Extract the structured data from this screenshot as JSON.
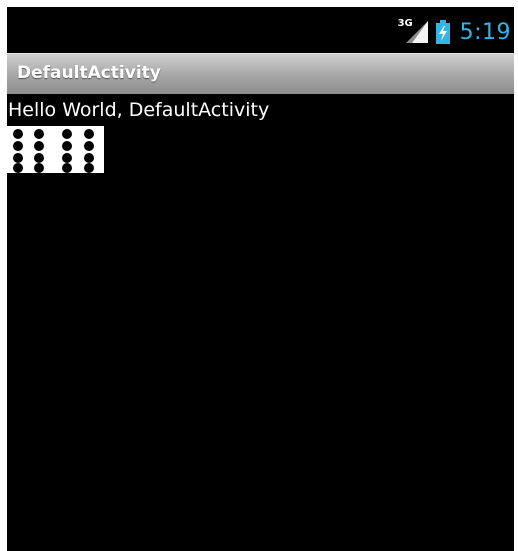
{
  "status_bar": {
    "network_label": "3G",
    "network_icon": "signal-icon",
    "battery_icon": "battery-charging-icon",
    "time": "5:19",
    "accent_color": "#33b5e5"
  },
  "action_bar": {
    "title": "DefaultActivity"
  },
  "content": {
    "hello_text": "Hello World, DefaultActivity",
    "image_icon": "dots-grid-image"
  }
}
